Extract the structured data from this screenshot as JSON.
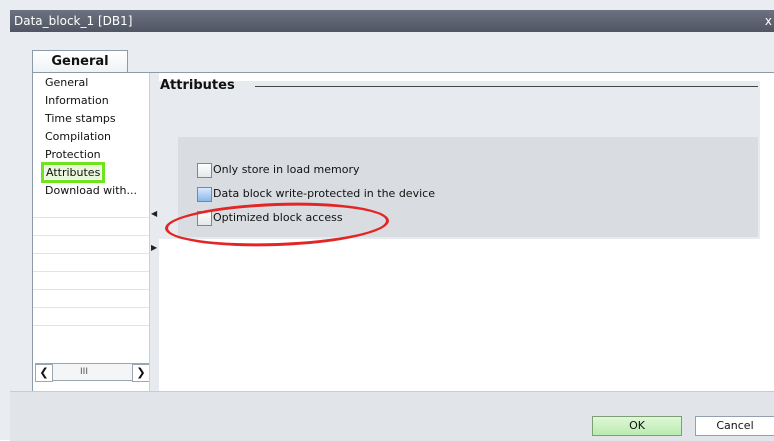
{
  "window": {
    "title": "Data_block_1 [DB1]",
    "close_glyph": "x"
  },
  "tabs": [
    {
      "label": "General"
    }
  ],
  "sidebar": {
    "items": [
      {
        "label": "General"
      },
      {
        "label": "Information"
      },
      {
        "label": "Time stamps"
      },
      {
        "label": "Compilation"
      },
      {
        "label": "Protection"
      },
      {
        "label": "Attributes"
      },
      {
        "label": "Download with..."
      }
    ],
    "hscroll_thumb": "III"
  },
  "main": {
    "section_title": "Attributes",
    "options": [
      {
        "label": "Only store in load memory",
        "checked": false
      },
      {
        "label": "Data block write-protected in the device",
        "checked": false
      },
      {
        "label": "Optimized block access",
        "checked": false
      }
    ]
  },
  "buttons": {
    "ok_label": "OK",
    "cancel_label": "Cancel"
  },
  "colors": {
    "highlight_red": "#e32526",
    "highlight_green": "#6fe31c",
    "ok_button": "#b9ebb0"
  }
}
